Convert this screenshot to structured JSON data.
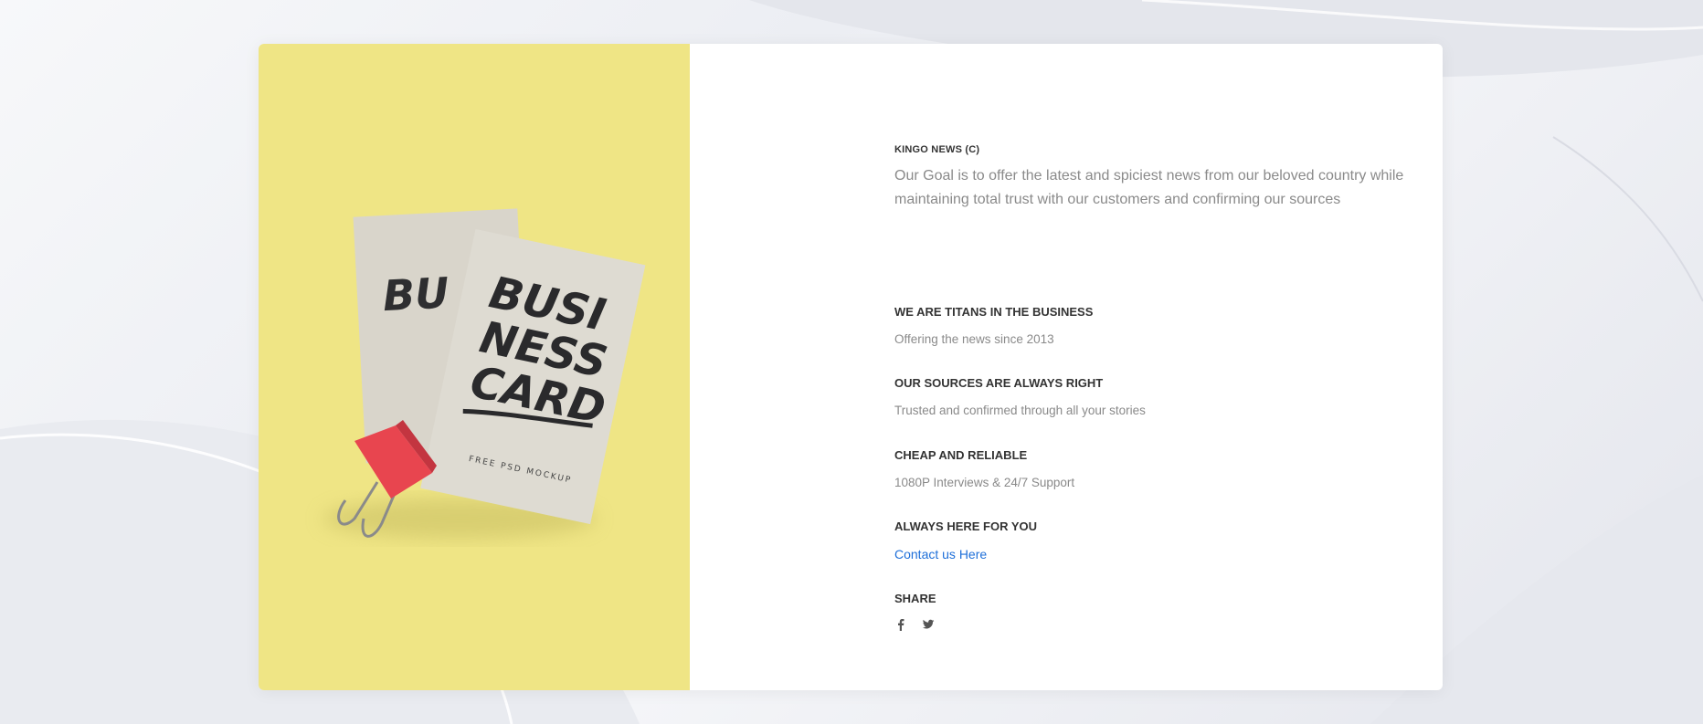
{
  "brand": "KINGO NEWS (C)",
  "intro": "Our Goal is to offer the latest and spiciest news from our beloved country while maintaining total trust with our customers and confirming our sources",
  "sections": [
    {
      "title": "WE ARE TITANS IN THE BUSINESS",
      "text": "Offering the news since 2013"
    },
    {
      "title": "OUR SOURCES ARE ALWAYS RIGHT",
      "text": "Trusted and confirmed through all your stories"
    },
    {
      "title": "CHEAP AND RELIABLE",
      "text": "1080P Interviews & 24/7 Support"
    },
    {
      "title": "ALWAYS HERE FOR YOU",
      "link": "Contact us Here"
    }
  ],
  "share": {
    "title": "SHARE",
    "icons": [
      "facebook-icon",
      "twitter-icon"
    ]
  },
  "image": {
    "card_text_line1": "BUSI",
    "card_text_line2": "NESS",
    "card_text_line3": "CARD",
    "card_subtext": "FREE PSD MOCKUP"
  },
  "colors": {
    "panel_yellow": "#efe585",
    "link_blue": "#1e6fd9",
    "clip_red": "#e8454f"
  }
}
